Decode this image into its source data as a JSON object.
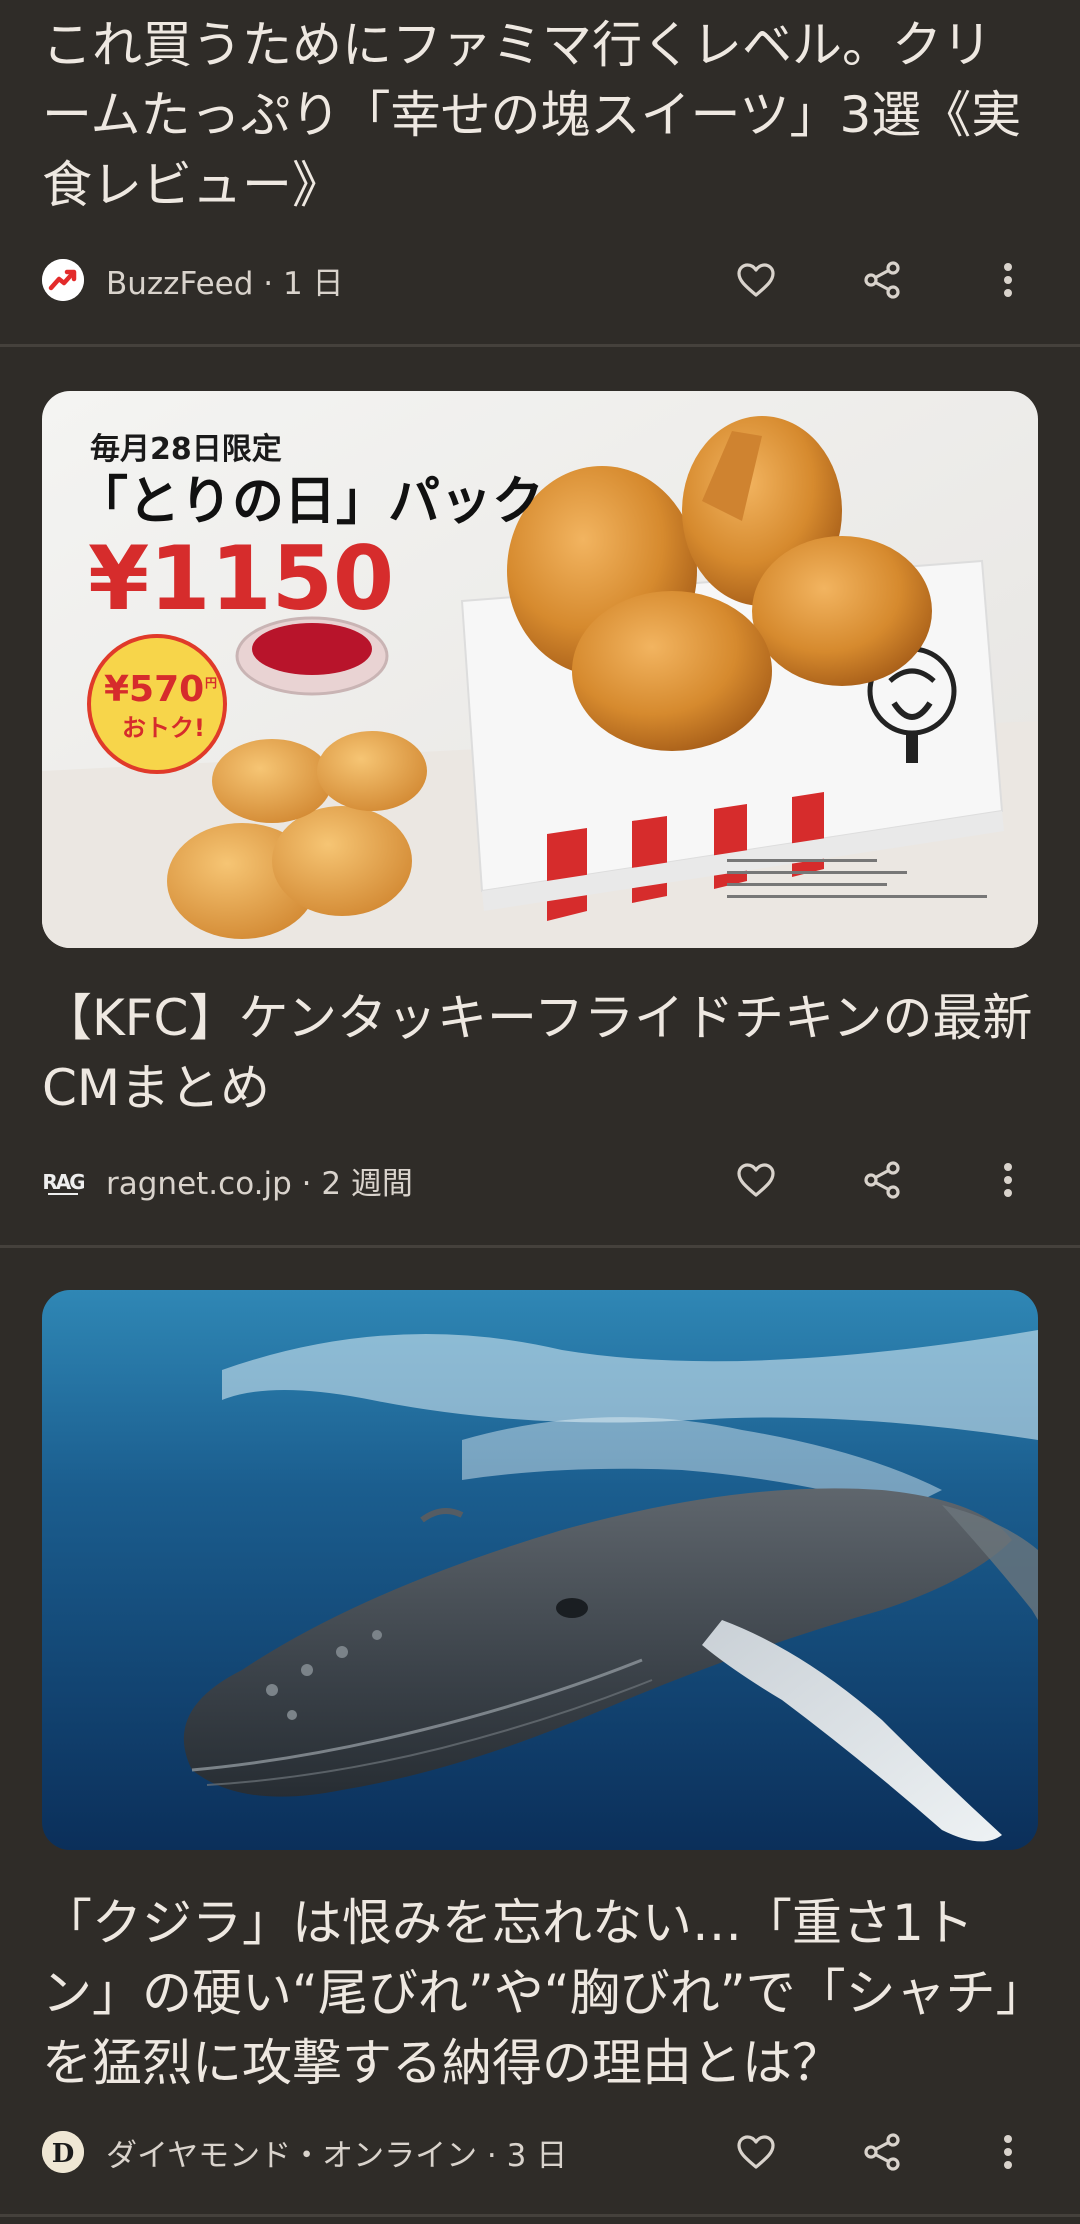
{
  "cards": [
    {
      "title": "これ買うためにファミマ行くレベル。クリームたっぷり「幸せの塊スイーツ」3選《実食レビュー》",
      "source": "BuzzFeed",
      "age": "1 日",
      "logo": "buzzfeed-trending-arrow"
    },
    {
      "title": "【KFC】ケンタッキーフライドチキンの最新CMまとめ",
      "source": "ragnet.co.jp",
      "age": "2 週間",
      "logo": "rag-logo",
      "logo_text": "RAG",
      "image": {
        "caption_small": "毎月28日限定",
        "caption_big": "「とりの日」パック",
        "price": "¥1150",
        "badge_amount": "¥570",
        "badge_suffix": "円",
        "badge_text": "おトク!"
      }
    },
    {
      "title": "「クジラ」は恨みを忘れない…「重さ1トン」の硬い“尾びれ”や“胸びれ”で「シャチ」を猛烈に攻撃する納得の理由とは？",
      "source": "ダイヤモンド・オンライン",
      "age": "3 日",
      "logo": "diamond-online-logo",
      "logo_text": "D"
    }
  ],
  "meta_separator": " · ",
  "icons": [
    "heart-icon",
    "share-icon",
    "more-vert-icon"
  ],
  "colors": {
    "background": "#2f2c28",
    "text": "#eee8e1",
    "divider": "#45413c",
    "kfc_red": "#d62c2c"
  }
}
